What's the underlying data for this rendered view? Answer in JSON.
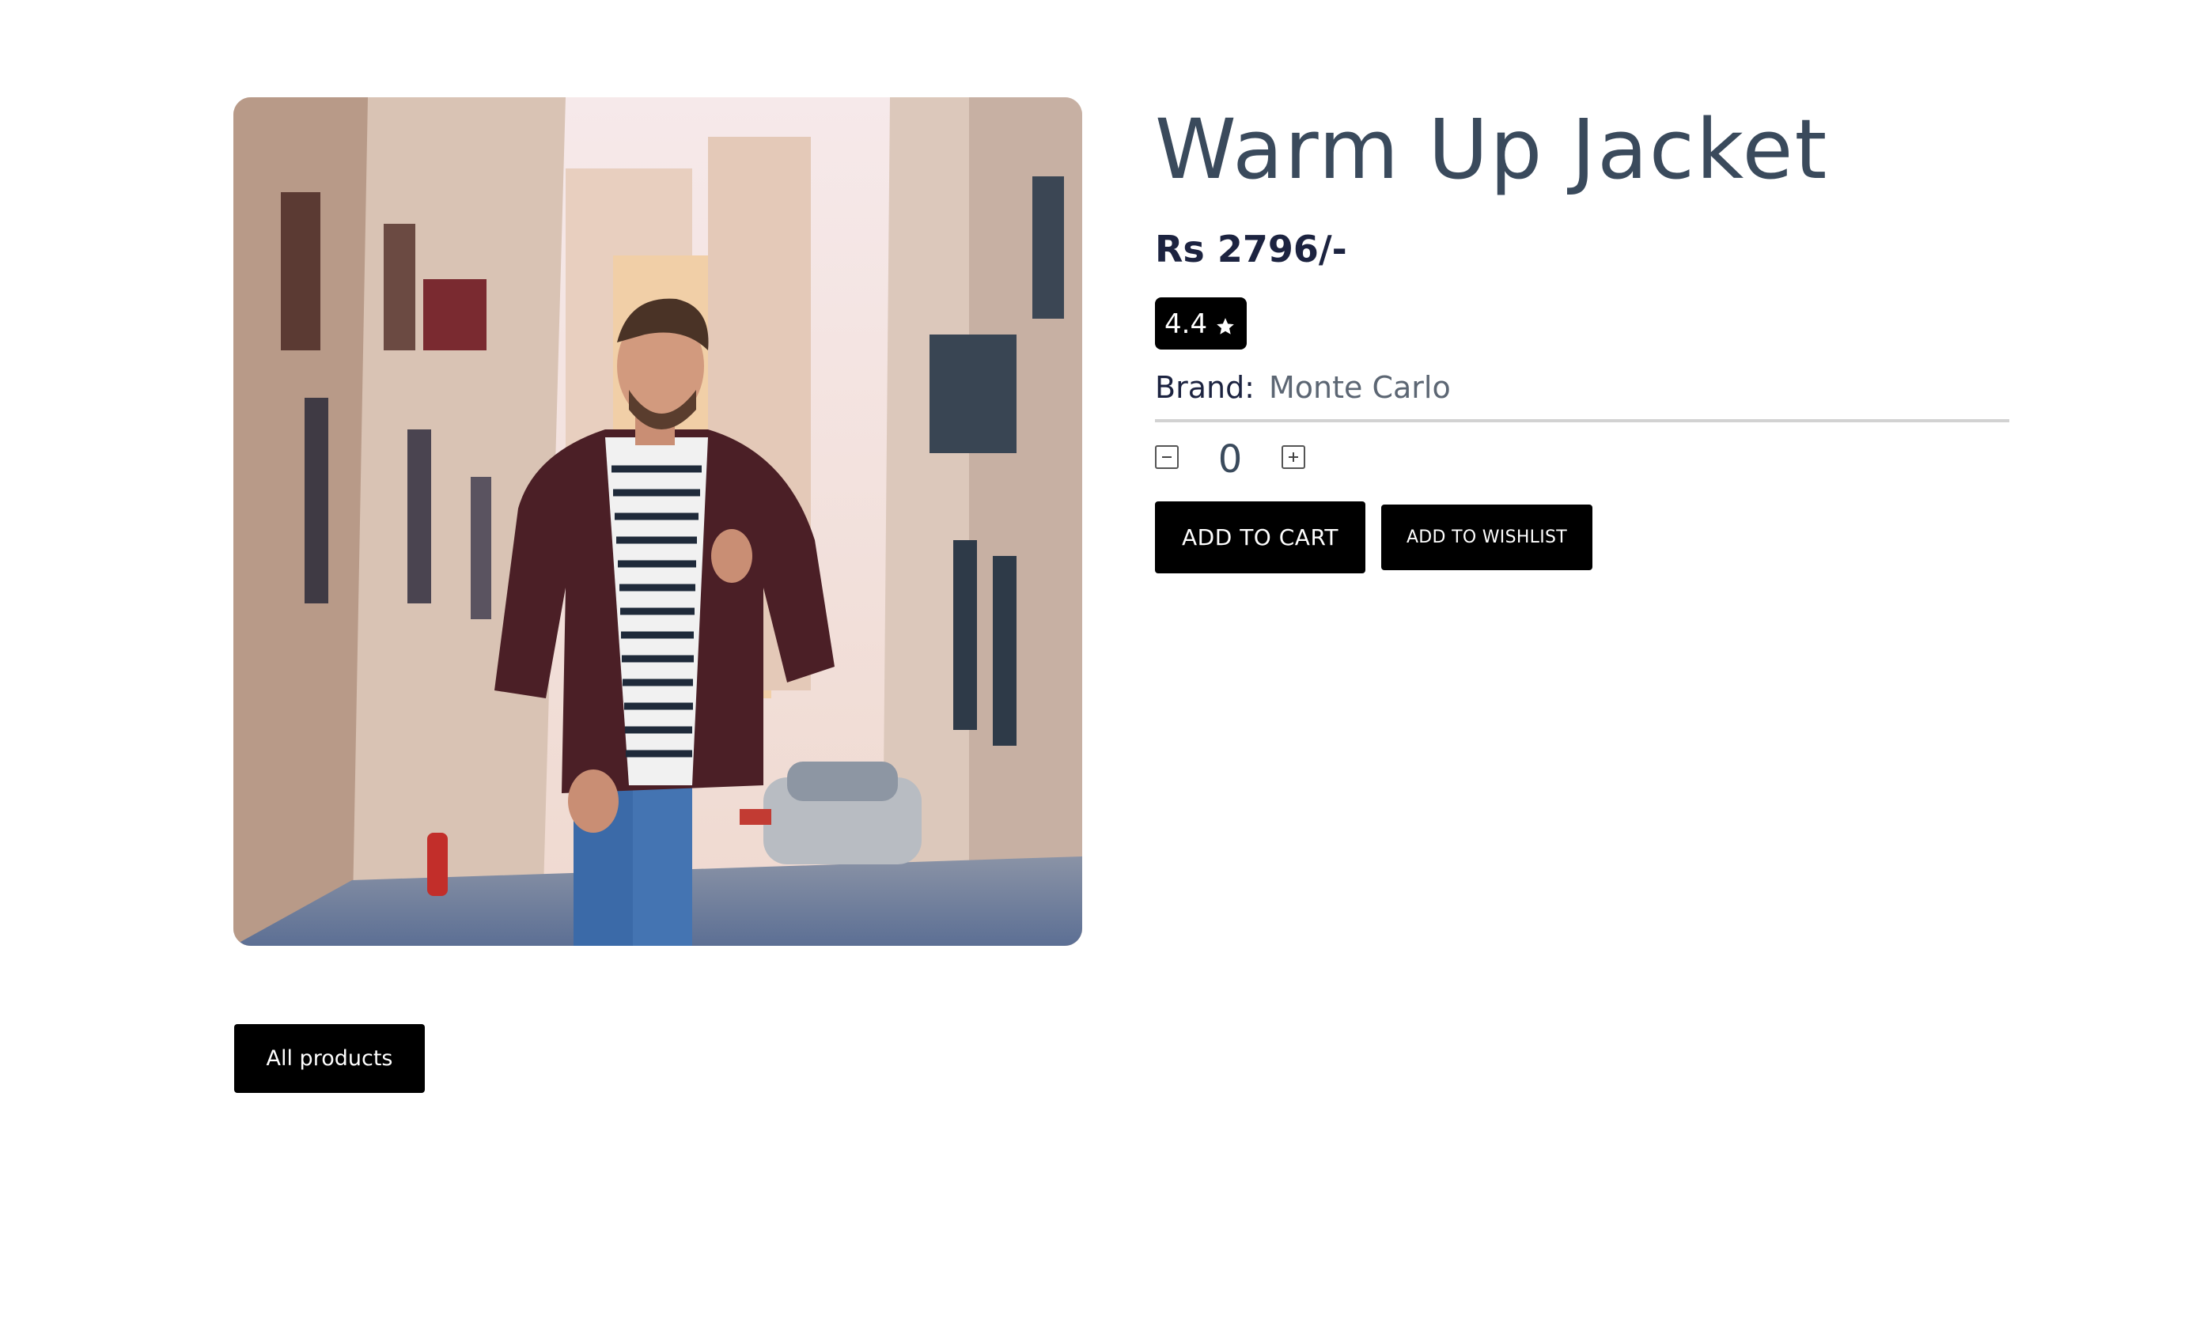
{
  "product": {
    "title": "Warm Up Jacket",
    "price": "Rs 2796/-",
    "rating": "4.4",
    "rating_icon": "star-icon",
    "brand_label": "Brand:",
    "brand_value": "Monte Carlo",
    "quantity": "0",
    "decrement_icon": "minus-square-icon",
    "increment_icon": "plus-square-icon"
  },
  "actions": {
    "add_to_cart": "ADD TO CART",
    "add_to_wishlist": "ADD TO WISHLIST",
    "all_products": "All products"
  },
  "colors": {
    "button_bg": "#000000",
    "button_text": "#ffffff",
    "title_color": "#3a4a5c",
    "price_color": "#1c2340",
    "brand_value_color": "#5c6673"
  }
}
